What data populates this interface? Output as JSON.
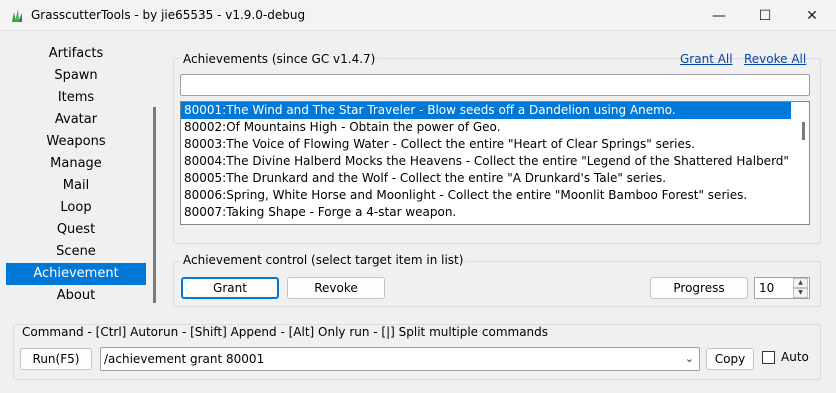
{
  "window": {
    "title": "GrasscutterTools  - by jie65535  - v1.9.0-debug",
    "controls": {
      "minimize": "—",
      "maximize": "☐",
      "close": "✕"
    }
  },
  "nav": {
    "items": [
      "Artifacts",
      "Spawn",
      "Items",
      "Avatar",
      "Weapons",
      "Manage",
      "Mail",
      "Loop",
      "Quest",
      "Scene",
      "Achievement",
      "About"
    ],
    "active": "Achievement"
  },
  "achievements": {
    "group_label": "Achievements (since GC v1.4.7)",
    "grant_all": "Grant All",
    "revoke_all": "Revoke All",
    "filter_value": "",
    "list": [
      "80001:The Wind and The Star Traveler - Blow seeds off a Dandelion using Anemo.",
      "80002:Of Mountains High - Obtain the power of Geo.",
      "80003:The Voice of Flowing Water - Collect the entire \"Heart of Clear Springs\" series.",
      "80004:The Divine Halberd Mocks the Heavens - Collect the entire \"Legend of the Shattered Halberd\" ser",
      "80005:The Drunkard and the Wolf - Collect the entire \"A Drunkard's Tale\" series.",
      "80006:Spring, White Horse and Moonlight - Collect the entire \"Moonlit Bamboo Forest\" series.",
      "80007:Taking Shape - Forge a 4-star weapon."
    ],
    "selected_index": 0
  },
  "control": {
    "group_label": "Achievement control (select target item in list)",
    "grant": "Grant",
    "revoke": "Revoke",
    "progress": "Progress",
    "progress_value": "10"
  },
  "command": {
    "label": "Command  - [Ctrl] Autorun  - [Shift] Append  - [Alt] Only run  - [|] Split multiple commands",
    "run": "Run(F5)",
    "value": "/achievement grant 80001",
    "copy": "Copy",
    "auto": "Auto"
  }
}
